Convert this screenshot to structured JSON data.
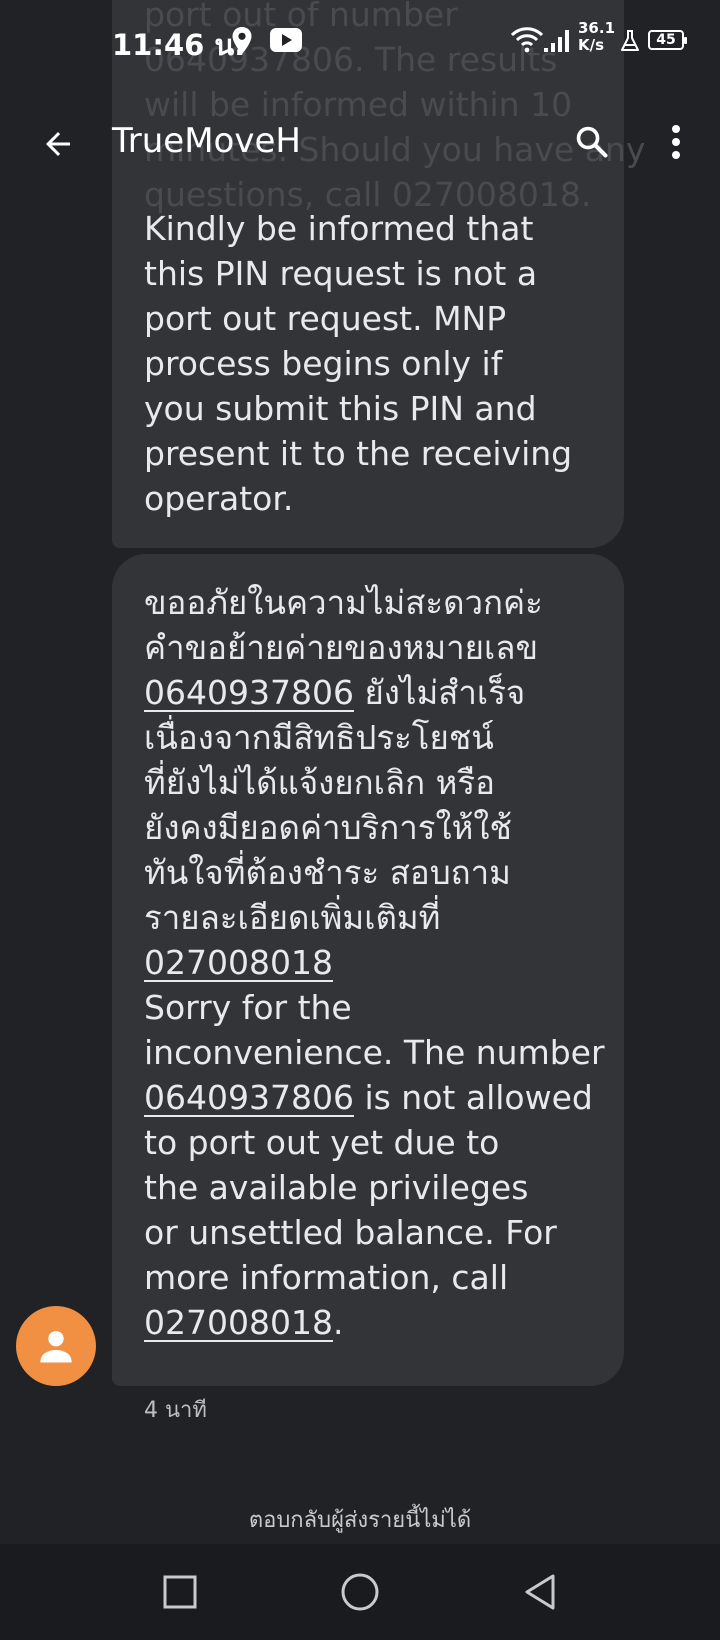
{
  "status_bar": {
    "time": "11:46 น.",
    "net_speed_value": "36.1",
    "net_speed_unit": "K/s",
    "battery": "45",
    "icons": [
      "location-icon",
      "youtube-icon",
      "wifi-icon",
      "signal-icon",
      "lab-icon",
      "battery-icon"
    ]
  },
  "app_bar": {
    "title": "TrueMoveH",
    "icons": [
      "back-arrow-icon",
      "search-icon",
      "more-vert-icon"
    ]
  },
  "conversation": {
    "scrolled_partial_lines": [
      "port out of number",
      "0640937806. The results",
      "will be informed within 10",
      "minutes. Should you have any",
      "questions, call 027008018."
    ],
    "message_1": {
      "lines": [
        "Kindly be informed that",
        "this PIN request is not a",
        "port out request. MNP",
        "process begins only if",
        "you submit this PIN and",
        "present it to the receiving",
        "operator."
      ]
    },
    "message_2": {
      "th_1": "ขออภัยในความไม่สะดวกค่ะ",
      "th_2": "คำขอย้ายค่ายของหมายเลข",
      "th_3_number": "0640937806",
      "th_3_rest": " ยังไม่สำเร็จ",
      "th_4": "เนื่องจากมีสิทธิประโยชน์",
      "th_5": "ที่ยังไม่ได้แจ้งยกเลิก หรือ",
      "th_6": "ยังคงมียอดค่าบริการให้ใช้",
      "th_7": "ทันใจที่ต้องชำระ สอบถาม",
      "th_8": "รายละเอียดเพิ่มเติมที่",
      "th_9_number": "027008018",
      "en_1": "Sorry for the",
      "en_2": "inconvenience. The number",
      "en_3_number": "0640937806",
      "en_3_rest": " is not allowed",
      "en_4": "to port out yet due to",
      "en_5": "the available privileges",
      "en_6": "or unsettled balance. For",
      "en_7": "more information, call",
      "en_8_number": "027008018",
      "en_8_rest": "."
    },
    "timestamp": "4 นาที",
    "no_reply_notice": "ตอบกลับผู้ส่งรายนี้ไม่ได้"
  },
  "colors": {
    "background": "#212226",
    "bubble": "#333437",
    "avatar": "#f18f43",
    "nav_bar": "#1a1b1e"
  }
}
